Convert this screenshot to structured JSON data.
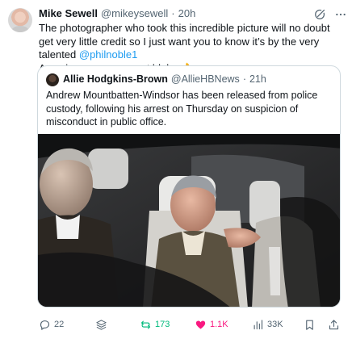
{
  "tweet": {
    "author_name": "Mike Sewell",
    "author_handle": "@mikeysewell",
    "separator": "·",
    "time": "20h",
    "text_before_link": "The photographer who took this incredible picture will no doubt get very little credit so I just want you to know it’s by the very talented ",
    "mention": "@philnoble1",
    "text_after_link": "Amazing snapper, great bloke 👌",
    "mention_color": "#1d9bf0"
  },
  "quoted_tweet": {
    "author_name": "Allie Hodgkins-Brown",
    "author_handle": "@AllieHBNews",
    "separator": "·",
    "time": "21h",
    "text": "Andrew Mountbatten-Windsor has been released from police custody, following his arrest on Thursday on suspicion of misconduct in public office."
  },
  "actions": {
    "replies": "22",
    "reposts": "173",
    "likes": "1.1K",
    "views": "33K",
    "repost_color": "#00ba7c",
    "like_color": "#f91880"
  },
  "icons": {
    "header": [
      "grok-icon",
      "more-icon"
    ],
    "action_bar": [
      "reply-icon",
      "grok-icon",
      "repost-icon",
      "like-icon",
      "views-icon",
      "bookmark-icon",
      "share-icon"
    ]
  }
}
